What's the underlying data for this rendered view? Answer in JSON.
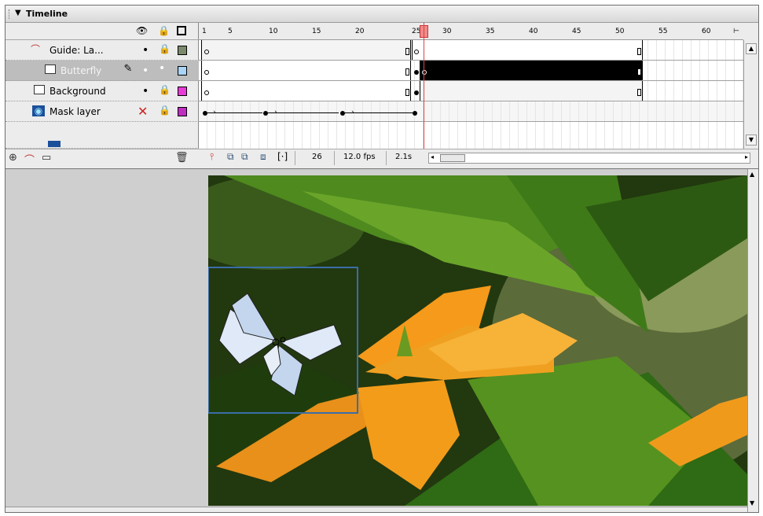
{
  "panel": {
    "title": "Timeline",
    "collapse_glyph": "▼"
  },
  "columns": {
    "eye_glyph": "👁",
    "lock_glyph": "🔒"
  },
  "layers": [
    {
      "name": "Guide: La...",
      "icon": "guide-layer-icon",
      "visible_glyph": "•",
      "lock_glyph": "🔒",
      "color": "#7a8a6a"
    },
    {
      "name": "Butterfly",
      "icon": "layer-icon",
      "edit_glyph": "✎",
      "visible_glyph": "•",
      "lock_glyph": "•",
      "color": "#a9d4f5"
    },
    {
      "name": "Background",
      "icon": "layer-icon",
      "visible_glyph": "•",
      "lock_glyph": "🔒",
      "color": "#e83ad6"
    },
    {
      "name": "Mask layer",
      "icon": "mask-layer-icon",
      "visible_glyph": "✕",
      "lock_glyph": "🔒",
      "color": "#c02ec0"
    }
  ],
  "ruler": {
    "ticks": [
      "1",
      "5",
      "10",
      "15",
      "20",
      "25",
      "30",
      "35",
      "40",
      "45",
      "50",
      "55",
      "60"
    ],
    "end_glyph": "⊢"
  },
  "status": {
    "current_frame": "26",
    "frame_rate": "12.0 fps",
    "elapsed": "2.1s"
  },
  "toolbar": {
    "add_layer": "⊕",
    "add_guide": "⌒",
    "add_folder": "▭",
    "delete": "🗑"
  },
  "colors": {
    "playhead": "#d44444",
    "accent_swatch_guide": "#7a8a6a"
  }
}
